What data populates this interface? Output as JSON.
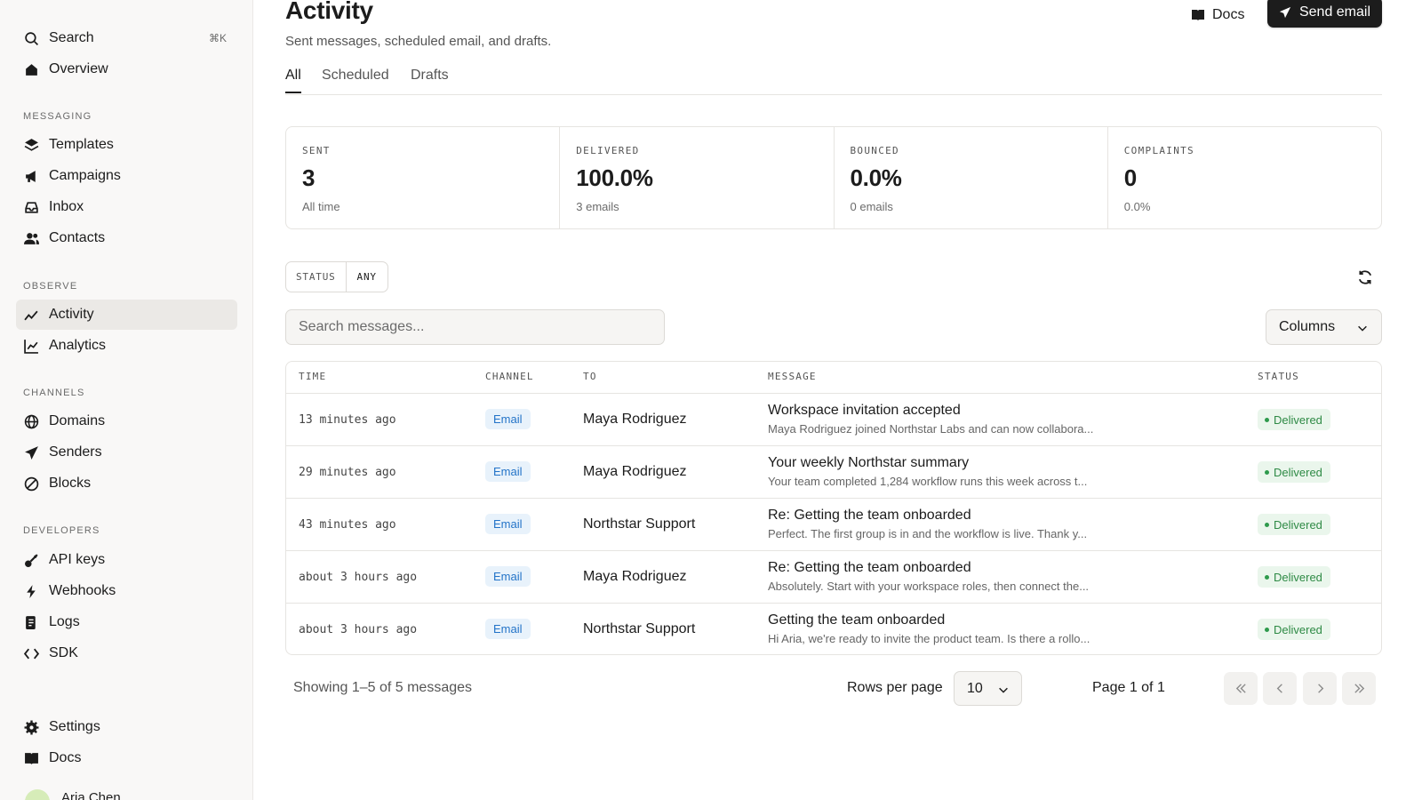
{
  "sidebar": {
    "search": {
      "label": "Search",
      "shortcut": "⌘K"
    },
    "overview": "Overview",
    "sections": {
      "messaging": "MESSAGING",
      "observe": "OBSERVE",
      "channels": "CHANNELS",
      "developers": "DEVELOPERS"
    },
    "items": {
      "templates": "Templates",
      "campaigns": "Campaigns",
      "inbox": "Inbox",
      "contacts": "Contacts",
      "activity": "Activity",
      "analytics": "Analytics",
      "domains": "Domains",
      "senders": "Senders",
      "blocks": "Blocks",
      "api_keys": "API keys",
      "webhooks": "Webhooks",
      "logs": "Logs",
      "sdk": "SDK",
      "settings": "Settings",
      "docs": "Docs"
    },
    "user": {
      "name": "Aria Chen"
    }
  },
  "header": {
    "title": "Activity",
    "subtitle": "Sent messages, scheduled email, and drafts.",
    "docs_label": "Docs",
    "send_label": "Send email"
  },
  "tabs": [
    "All",
    "Scheduled",
    "Drafts"
  ],
  "stats": [
    {
      "label": "SENT",
      "value": "3",
      "sub": "All time"
    },
    {
      "label": "DELIVERED",
      "value": "100.0%",
      "sub": "3 emails"
    },
    {
      "label": "BOUNCED",
      "value": "0.0%",
      "sub": "0 emails"
    },
    {
      "label": "COMPLAINTS",
      "value": "0",
      "sub": "0.0%"
    }
  ],
  "filter": {
    "key": "STATUS",
    "value": "ANY"
  },
  "search": {
    "placeholder": "Search messages..."
  },
  "columns_label": "Columns",
  "table": {
    "headers": {
      "time": "TIME",
      "channel": "CHANNEL",
      "to": "TO",
      "message": "MESSAGE",
      "status": "STATUS"
    },
    "rows": [
      {
        "time": "13 minutes ago",
        "channel": "Email",
        "to": "Maya Rodriguez",
        "title": "Workspace invitation accepted",
        "preview": "Maya Rodriguez joined Northstar Labs and can now collabora...",
        "status": "Delivered"
      },
      {
        "time": "29 minutes ago",
        "channel": "Email",
        "to": "Maya Rodriguez",
        "title": "Your weekly Northstar summary",
        "preview": "Your team completed 1,284 workflow runs this week across t...",
        "status": "Delivered"
      },
      {
        "time": "43 minutes ago",
        "channel": "Email",
        "to": "Northstar Support",
        "title": "Re: Getting the team onboarded",
        "preview": "Perfect. The first group is in and the workflow is live. Thank y...",
        "status": "Delivered"
      },
      {
        "time": "about 3 hours ago",
        "channel": "Email",
        "to": "Maya Rodriguez",
        "title": "Re: Getting the team onboarded",
        "preview": "Absolutely. Start with your workspace roles, then connect the...",
        "status": "Delivered"
      },
      {
        "time": "about 3 hours ago",
        "channel": "Email",
        "to": "Northstar Support",
        "title": "Getting the team onboarded",
        "preview": "Hi Aria, we're ready to invite the product team. Is there a rollo...",
        "status": "Delivered"
      }
    ]
  },
  "pagination": {
    "showing": "Showing 1–5 of 5 messages",
    "rows_per_page_label": "Rows per page",
    "rows_per_page": "10",
    "page_label": "Page 1 of 1"
  }
}
